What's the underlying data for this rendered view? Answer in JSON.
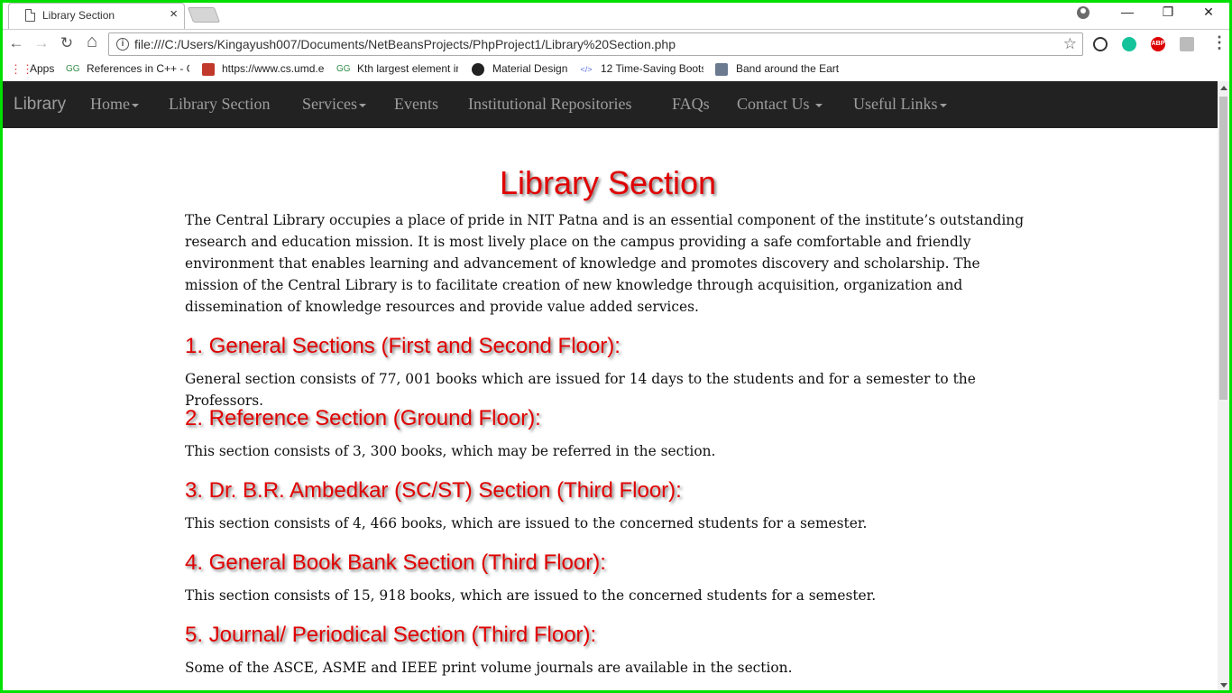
{
  "browser": {
    "tab_title": "Library Section",
    "tab_close": "×",
    "url": "file:///C:/Users/Kingayush007/Documents/NetBeansProjects/PhpProject1/Library%20Section.php",
    "window_controls": {
      "minimize": "—",
      "restore": "❐",
      "close": "✕"
    },
    "nav": {
      "back": "←",
      "forward": "→",
      "reload": "↻",
      "home": "⌂"
    },
    "bookmarks": [
      {
        "label": "Apps",
        "icon": "apps-icon"
      },
      {
        "label": "References in C++ - G",
        "icon": "geeksforgeeks-icon"
      },
      {
        "label": "https://www.cs.umd.e",
        "icon": "cube-icon"
      },
      {
        "label": "Kth largest element in",
        "icon": "geeksforgeeks-icon"
      },
      {
        "label": "Material Design",
        "icon": "material-icon"
      },
      {
        "label": "12 Time-Saving Boots",
        "icon": "code-icon"
      },
      {
        "label": "Band around the Eart",
        "icon": "band-icon"
      }
    ]
  },
  "navbar": {
    "brand": "Library",
    "items": [
      {
        "label": "Home",
        "dropdown": true
      },
      {
        "label": "Library Section",
        "dropdown": false
      },
      {
        "label": "Services",
        "dropdown": true
      },
      {
        "label": "Events",
        "dropdown": false
      },
      {
        "label": "Institutional Repositories",
        "dropdown": false
      },
      {
        "label": "FAQs",
        "dropdown": false
      },
      {
        "label": "Contact Us",
        "dropdown": true
      },
      {
        "label": "Useful Links",
        "dropdown": true
      }
    ]
  },
  "page": {
    "title": "Library Section",
    "intro": "The Central Library occupies a place of pride in NIT Patna and is an essential component of the institute’s outstanding research and education mission. It is most lively place on the campus providing a safe comfortable and friendly environment that enables learning and advancement of knowledge and promotes discovery and scholarship. The mission of the Central Library is to facilitate creation of new knowledge through acquisition, organization and dissemination of knowledge resources and provide value added services.",
    "sections": [
      {
        "heading": "1. General Sections (First and Second Floor):",
        "text": "General section consists of 77, 001 books which are issued for 14 days to the students and for a semester to the Professors."
      },
      {
        "heading": "2. Reference Section (Ground Floor):",
        "text": "This section consists of 3, 300 books, which may be referred in the section."
      },
      {
        "heading": "3. Dr. B.R. Ambedkar (SC/ST) Section (Third Floor):",
        "text": "This section consists of 4, 466 books, which are issued to the concerned students for a semester."
      },
      {
        "heading": "4. General Book Bank Section (Third Floor):",
        "text": "This section consists of 15, 918 books, which are issued to the concerned students for a semester."
      },
      {
        "heading": "5. Journal/ Periodical Section (Third Floor):",
        "text": "Some of the ASCE, ASME and IEEE print volume journals are available in the section."
      }
    ]
  },
  "colors": {
    "frame": "#00e000",
    "navbar_bg": "#222222",
    "nav_text": "#9d9d9d",
    "heading": "#e00000"
  }
}
